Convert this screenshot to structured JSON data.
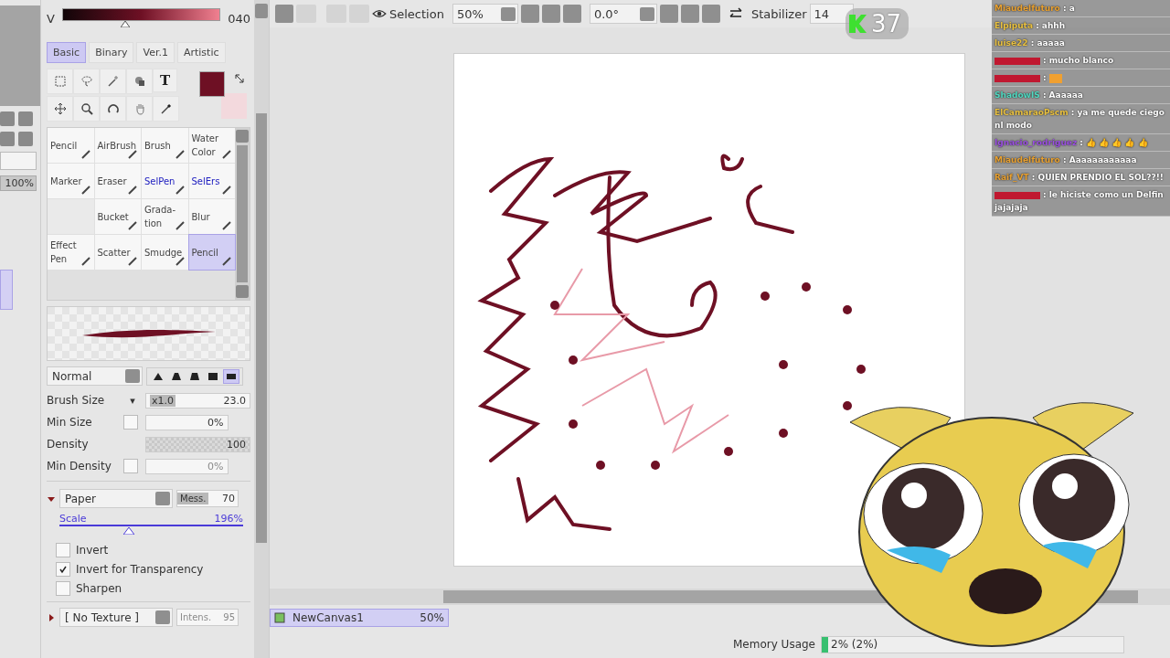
{
  "color_slider": {
    "channel": "V",
    "value": "040",
    "level": 0.4
  },
  "brush_tabs": [
    {
      "label": "Basic",
      "selected": true
    },
    {
      "label": "Binary",
      "selected": false
    },
    {
      "label": "Ver.1",
      "selected": false
    },
    {
      "label": "Artistic",
      "selected": false
    }
  ],
  "text_tool": "T",
  "swatches": [
    {
      "color": "#6e1024"
    },
    {
      "color": "#f3d9dd"
    }
  ],
  "brushes": [
    {
      "kind": "brush",
      "label": "Pencil",
      "selected": false
    },
    {
      "kind": "brush",
      "label": "AirBrush",
      "selected": false
    },
    {
      "kind": "brush",
      "label": "Brush",
      "selected": false
    },
    {
      "kind": "brush",
      "label": "Water Color",
      "selected": false
    },
    {
      "kind": "brush",
      "label": "Marker",
      "selected": false
    },
    {
      "kind": "brush",
      "label": "Eraser",
      "selected": false
    },
    {
      "kind": "selection",
      "label": "SelPen",
      "selected": false
    },
    {
      "kind": "selection",
      "label": "SelErs",
      "selected": false
    },
    {
      "kind": "empty"
    },
    {
      "kind": "brush",
      "label": "Bucket",
      "selected": false
    },
    {
      "kind": "brush",
      "label": "Grada-tion",
      "selected": false
    },
    {
      "kind": "brush",
      "label": "Blur",
      "selected": false
    },
    {
      "kind": "brush",
      "label": "Effect Pen",
      "selected": false
    },
    {
      "kind": "brush",
      "label": "Scatter",
      "selected": false
    },
    {
      "kind": "brush",
      "label": "Smudge",
      "selected": false
    },
    {
      "kind": "brush",
      "label": "Pencil",
      "selected": true
    }
  ],
  "blend_mode": "Normal",
  "brush_shapes": [
    {
      "selected": false
    },
    {
      "selected": false
    },
    {
      "selected": false
    },
    {
      "selected": false
    },
    {
      "selected": true
    }
  ],
  "brush_size": {
    "label": "Brush Size",
    "menu": "▾",
    "multiplier": "x1.0",
    "value": "23.0"
  },
  "min_size": {
    "label": "Min Size",
    "value": "0%"
  },
  "density": {
    "label": "Density",
    "value": "100"
  },
  "min_density": {
    "label": "Min Density",
    "value": "0%",
    "checked": false
  },
  "paper": {
    "expanded": true,
    "texture": "Paper",
    "mess_label": "Mess.",
    "mess_value": "70",
    "scale_label": "Scale",
    "scale_value": "196%",
    "level": 0.38
  },
  "options": [
    {
      "label": "Invert",
      "checked": false
    },
    {
      "label": "Invert for Transparency",
      "checked": true
    },
    {
      "label": "Sharpen",
      "checked": false
    }
  ],
  "texture": {
    "expanded": false,
    "name": "[ No Texture ]",
    "intensity_label": "Intens.",
    "intensity_value": "95"
  },
  "layer_opacity": "100%",
  "toolbar": {
    "selection_label": "Selection",
    "zoom": "50%",
    "rotation": "0.0°",
    "stabilizer_label": "Stabilizer",
    "stabilizer": "14"
  },
  "viewer_count": "37",
  "chat": [
    {
      "user": "Miaudelfuturo",
      "color": "#e8a030",
      "text": ": a"
    },
    {
      "user": "Elpiputa",
      "color": "#e8c040",
      "text": ": ahhh"
    },
    {
      "user": "luise22",
      "color": "#e8c040",
      "text": ": aaaaa"
    },
    {
      "color": "#c01830",
      "text": ": mucho blanco"
    },
    {
      "color": "#c01830",
      "text": ":",
      "emote": true
    },
    {
      "user": "ShadowIS",
      "color": "#50d8c0",
      "text": ": Aaaaaa"
    },
    {
      "user": "ElCamaraoPscm",
      "color": "#e8c040",
      "text": ": ya me quede ciego nl modo"
    },
    {
      "user": "Ignacio_rodriguez",
      "color": "#9a50e0",
      "text": ": 👍 👍 👍 👍 👍"
    },
    {
      "user": "Miaudelfuturo",
      "color": "#e8a030",
      "text": ": Aaaaaaaaaaaa"
    },
    {
      "user": "Raif_VT",
      "color": "#e8a030",
      "text": ": QUIEN PRENDIO EL SOL??!!"
    },
    {
      "color": "#c01830",
      "text": ": le hiciste como un Delfin jajajaja"
    }
  ],
  "canvas_tab": {
    "name": "NewCanvas1",
    "zoom": "50%",
    "selected": true
  },
  "status": {
    "memory_label": "Memory Usage",
    "memory_value": "2% (2%)",
    "level": 0.02
  }
}
